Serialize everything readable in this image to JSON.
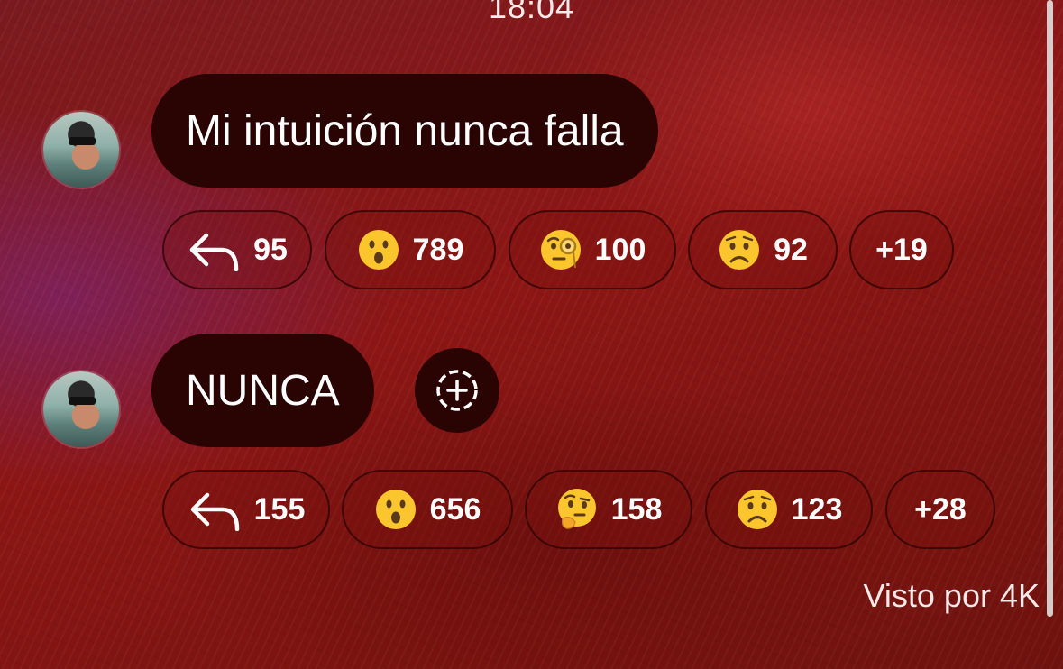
{
  "timestamp": "18:04",
  "messages": [
    {
      "text": "Mi intuición nunca falla",
      "reactions": {
        "replies": "95",
        "items": [
          {
            "emoji": "surprised-face",
            "count": "789"
          },
          {
            "emoji": "face-with-monocle",
            "count": "100"
          },
          {
            "emoji": "worried-face",
            "count": "92"
          }
        ],
        "more": "+19"
      }
    },
    {
      "text": "NUNCA",
      "reactions": {
        "replies": "155",
        "items": [
          {
            "emoji": "surprised-face",
            "count": "656"
          },
          {
            "emoji": "thinking-face",
            "count": "158"
          },
          {
            "emoji": "worried-face",
            "count": "123"
          }
        ],
        "more": "+28"
      }
    }
  ],
  "seen_by": "Visto por 4K",
  "colors": {
    "bubble": "#2a0403",
    "background": "#8c1614",
    "emoji_yellow": "#fbc52d"
  }
}
